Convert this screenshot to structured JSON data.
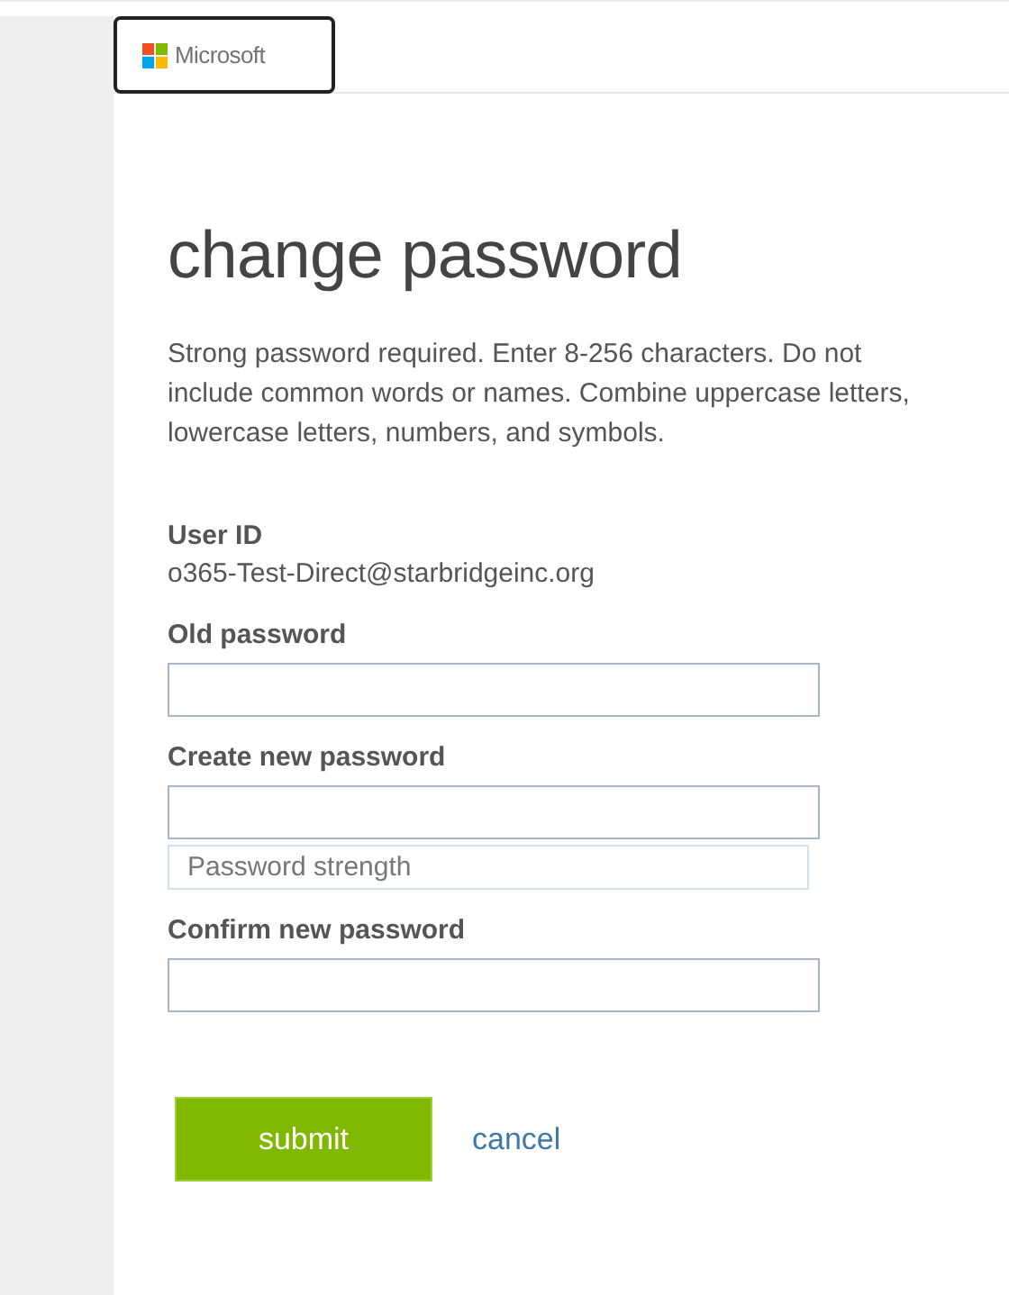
{
  "header": {
    "logo_text": "Microsoft"
  },
  "title": "change password",
  "description": "Strong password required. Enter 8-256 characters. Do not include common words or names. Combine uppercase letters, lowercase letters, numbers, and symbols.",
  "user_id": {
    "label": "User ID",
    "value": "o365-Test-Direct@starbridgeinc.org"
  },
  "fields": [
    {
      "label": "Old password"
    },
    {
      "label": "Create new password",
      "strength_label": "Password strength"
    },
    {
      "label": "Confirm new password"
    }
  ],
  "buttons": {
    "submit": "submit",
    "cancel": "cancel"
  }
}
